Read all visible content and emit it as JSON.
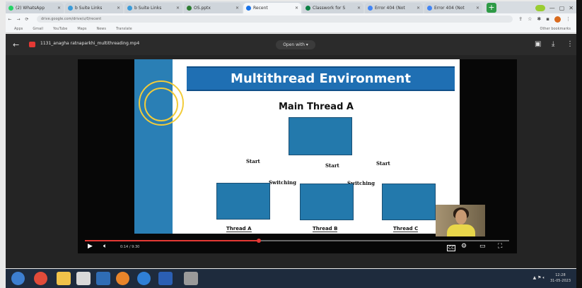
{
  "browser": {
    "tabs": [
      {
        "label": "(2) WhatsApp",
        "color": "#25d366",
        "active": false
      },
      {
        "label": "b Suite Links",
        "color": "#3a9bd9",
        "active": false
      },
      {
        "label": "b Suite Links",
        "color": "#3a9bd9",
        "active": false
      },
      {
        "label": "OS.pptx",
        "color": "#2e7d32",
        "active": false
      },
      {
        "label": "Recent",
        "color": "#1a73e8",
        "active": true
      },
      {
        "label": "Classwork for S",
        "color": "#0b8043",
        "active": false
      },
      {
        "label": "Error 404 (Not",
        "color": "#4285f4",
        "active": false
      },
      {
        "label": "Error 404 (Not",
        "color": "#4285f4",
        "active": false
      }
    ],
    "new_tab": "+",
    "url": "drive.google.com/drive/u/0/recent",
    "bookmarks": [
      "Apps",
      "Gmail",
      "YouTube",
      "Maps",
      "News",
      "Translate",
      "Other bookmarks"
    ]
  },
  "viewer": {
    "file_name": "1131_anagha ratnaparkhi_multithreading.mp4",
    "open_with": "Open with",
    "slide": {
      "title": "Multithread Environment",
      "main_thread": "Main Thread A",
      "start_label": "Start",
      "switching_label": "Switching",
      "threads": [
        "Thread A",
        "Thread B",
        "Thread C"
      ]
    },
    "player": {
      "progress": 0.41,
      "time": "0:14 / 9:30",
      "cc": "CC"
    }
  },
  "taskbar": {
    "time": "12:28",
    "date": "31-05-2023"
  }
}
